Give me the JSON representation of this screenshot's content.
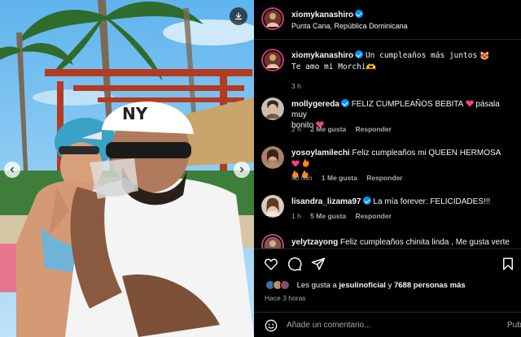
{
  "post": {
    "author": "xiomykanashiro",
    "location": "Punta Cana, República Dominicana"
  },
  "caption": {
    "user": "xiomykanashiro",
    "line1": "Un cumpleaños más juntos",
    "line2": "Te amo mi Morchi",
    "time": "3 h"
  },
  "cap_emoji": {
    "face": "😻",
    "hearthands": "🫶"
  },
  "comments": [
    {
      "user": "mollygereda",
      "verified": true,
      "text": "FELIZ CUMPLEAÑOS BEBITA",
      "text2": "pásala muy",
      "text3": "bonito",
      "time": "2 h",
      "likes": "2 Me gusta",
      "reply": "Responder"
    },
    {
      "user": "yosoylamilechi",
      "verified": false,
      "text": "Feliz cumpleaños mi QUEEN HERMOSA",
      "time": "40 min",
      "likes": "1 Me gusta",
      "reply": "Responder"
    },
    {
      "user": "lisandra_lizama97",
      "verified": true,
      "text": "La mía forever: FELICIDADES!!!",
      "time": "1 h",
      "likes": "5 Me gusta",
      "reply": "Responder"
    },
    {
      "user": "yelytzayong",
      "verified": false,
      "text": "Feliz cumpleaños chinita linda , Me gusta verte"
    }
  ],
  "likes": {
    "prefix": "Les gusta a",
    "user": "jesulinoficial",
    "conj": "y",
    "others": "7688 personas más"
  },
  "posted": "Hace 3 horas",
  "add_comment": {
    "placeholder": "Añade un comentario...",
    "publish": "Pub"
  },
  "icons": {
    "download": "download-icon",
    "prev": "chevron-left-icon",
    "next": "chevron-right-icon",
    "like": "heart-icon",
    "comment": "comment-icon",
    "share": "send-icon",
    "save": "bookmark-icon",
    "emoji": "emoji-icon"
  },
  "colors": {
    "background": "#000000",
    "verified": "#0095f6",
    "muted": "#a8a8a8",
    "heart_pink": "#ff3d8b"
  }
}
